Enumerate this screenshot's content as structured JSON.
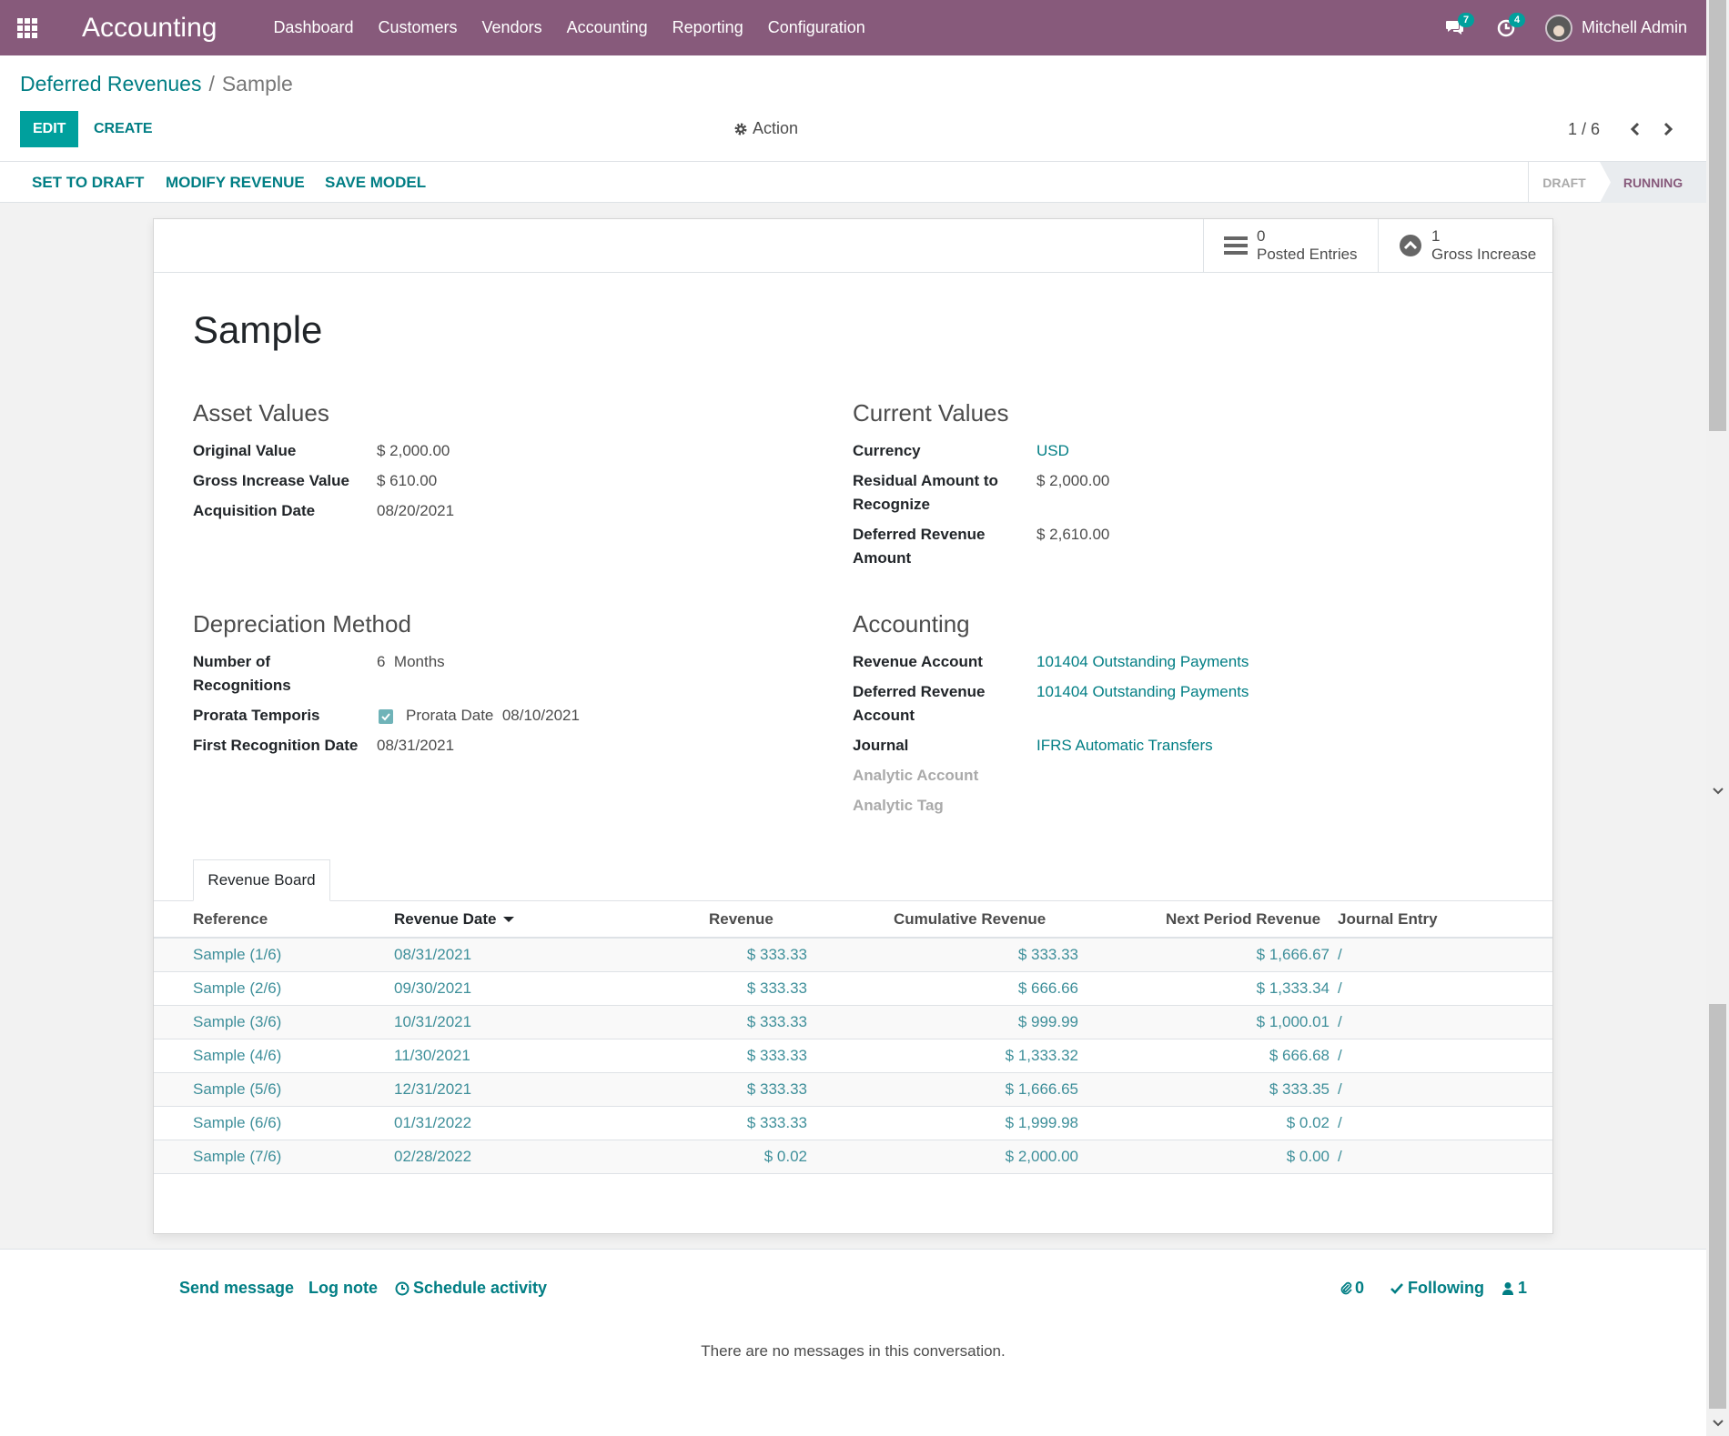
{
  "navbar": {
    "brand": "Accounting",
    "menu": [
      "Dashboard",
      "Customers",
      "Vendors",
      "Accounting",
      "Reporting",
      "Configuration"
    ],
    "messages_badge": "7",
    "activities_badge": "4",
    "user_name": "Mitchell Admin"
  },
  "breadcrumb": {
    "parent": "Deferred Revenues",
    "separator": "/",
    "current": "Sample"
  },
  "buttons": {
    "edit": "EDIT",
    "create": "CREATE",
    "action": "Action"
  },
  "pager": {
    "value": "1 / 6"
  },
  "statusbar": {
    "buttons": [
      "SET TO DRAFT",
      "MODIFY REVENUE",
      "SAVE MODEL"
    ],
    "states": [
      "DRAFT",
      "RUNNING"
    ],
    "active_state": "RUNNING"
  },
  "stat_buttons": {
    "posted_entries": {
      "value": "0",
      "label": "Posted Entries"
    },
    "gross_increase": {
      "value": "1",
      "label": "Gross Increase"
    }
  },
  "form": {
    "title": "Sample",
    "asset_values": {
      "title": "Asset Values",
      "original_value_label": "Original Value",
      "original_value": "$ 2,000.00",
      "gross_increase_label": "Gross Increase Value",
      "gross_increase": "$ 610.00",
      "acquisition_date_label": "Acquisition Date",
      "acquisition_date": "08/20/2021"
    },
    "current_values": {
      "title": "Current Values",
      "currency_label": "Currency",
      "currency": "USD",
      "residual_label_1": "Residual Amount to",
      "residual_label_2": "Recognize",
      "residual": "$ 2,000.00",
      "deferred_amount_label_1": "Deferred Revenue",
      "deferred_amount_label_2": "Amount",
      "deferred_amount": "$ 2,610.00"
    },
    "depreciation": {
      "title": "Depreciation Method",
      "recognitions_label_1": "Number of",
      "recognitions_label_2": "Recognitions",
      "recognitions_count": "6",
      "recognitions_unit": "Months",
      "prorata_label": "Prorata Temporis",
      "prorata_checked": true,
      "prorata_date_label": "Prorata Date",
      "prorata_date": "08/10/2021",
      "first_recognition_label": "First Recognition Date",
      "first_recognition": "08/31/2021"
    },
    "accounting": {
      "title": "Accounting",
      "revenue_account_label": "Revenue Account",
      "revenue_account": "101404 Outstanding Payments",
      "deferred_account_label_1": "Deferred Revenue",
      "deferred_account_label_2": "Account",
      "deferred_account": "101404 Outstanding Payments",
      "journal_label": "Journal",
      "journal": "IFRS Automatic Transfers",
      "analytic_account_label": "Analytic Account",
      "analytic_tag_label": "Analytic Tag"
    }
  },
  "revenue_board": {
    "tab_label": "Revenue Board",
    "columns": [
      "Reference",
      "Revenue Date",
      "Revenue",
      "Cumulative Revenue",
      "Next Period Revenue",
      "Journal Entry"
    ],
    "sorted_column": "Revenue Date",
    "rows": [
      {
        "reference": "Sample (1/6)",
        "date": "08/31/2021",
        "revenue": "$ 333.33",
        "cumulative": "$ 333.33",
        "next": "$ 1,666.67",
        "entry": "/"
      },
      {
        "reference": "Sample (2/6)",
        "date": "09/30/2021",
        "revenue": "$ 333.33",
        "cumulative": "$ 666.66",
        "next": "$ 1,333.34",
        "entry": "/"
      },
      {
        "reference": "Sample (3/6)",
        "date": "10/31/2021",
        "revenue": "$ 333.33",
        "cumulative": "$ 999.99",
        "next": "$ 1,000.01",
        "entry": "/"
      },
      {
        "reference": "Sample (4/6)",
        "date": "11/30/2021",
        "revenue": "$ 333.33",
        "cumulative": "$ 1,333.32",
        "next": "$ 666.68",
        "entry": "/"
      },
      {
        "reference": "Sample (5/6)",
        "date": "12/31/2021",
        "revenue": "$ 333.33",
        "cumulative": "$ 1,666.65",
        "next": "$ 333.35",
        "entry": "/"
      },
      {
        "reference": "Sample (6/6)",
        "date": "01/31/2022",
        "revenue": "$ 333.33",
        "cumulative": "$ 1,999.98",
        "next": "$ 0.02",
        "entry": "/"
      },
      {
        "reference": "Sample (7/6)",
        "date": "02/28/2022",
        "revenue": "$ 0.02",
        "cumulative": "$ 2,000.00",
        "next": "$ 0.00",
        "entry": "/"
      }
    ]
  },
  "chatter": {
    "send_message": "Send message",
    "log_note": "Log note",
    "schedule_activity": "Schedule activity",
    "attachments_count": "0",
    "following": "Following",
    "followers_count": "1",
    "empty_text": "There are no messages in this conversation."
  },
  "colors": {
    "navbar": "#875a7b",
    "accent": "#00a09d",
    "link": "#017e84"
  }
}
